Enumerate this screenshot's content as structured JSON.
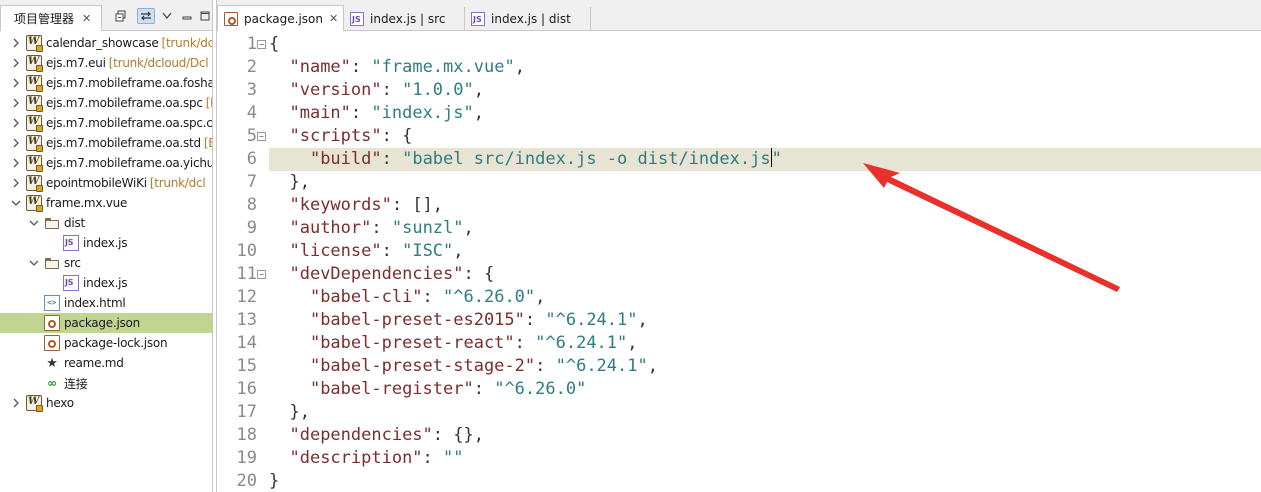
{
  "left_panel": {
    "tab_title": "项目管理器",
    "tree": [
      {
        "label": "calendar_showcase",
        "decor": "[trunk/dcloud/Dc",
        "icon": "project-icon",
        "level": 0,
        "expanded": false
      },
      {
        "label": "ejs.m7.eui",
        "decor": "[trunk/dcloud/Dcl",
        "icon": "project-icon",
        "level": 0,
        "expanded": false
      },
      {
        "label": "ejs.m7.mobileframe.oa.fosha",
        "decor": "",
        "icon": "project-icon",
        "level": 0,
        "expanded": false
      },
      {
        "label": "ejs.m7.mobileframe.oa.spc",
        "decor": "[l",
        "icon": "project-icon",
        "level": 0,
        "expanded": false
      },
      {
        "label": "ejs.m7.mobileframe.oa.spc.c",
        "decor": "",
        "icon": "project-icon",
        "level": 0,
        "expanded": false
      },
      {
        "label": "ejs.m7.mobileframe.oa.std",
        "decor": "[E",
        "icon": "project-icon",
        "level": 0,
        "expanded": false
      },
      {
        "label": "ejs.m7.mobileframe.oa.yichu",
        "decor": "",
        "icon": "project-icon",
        "level": 0,
        "expanded": false
      },
      {
        "label": "epointmobileWiKi",
        "decor": "[trunk/dcl",
        "icon": "project-icon",
        "level": 0,
        "expanded": false
      },
      {
        "label": "frame.mx.vue",
        "decor": "",
        "icon": "project-icon",
        "level": 0,
        "expanded": true
      },
      {
        "label": "dist",
        "decor": "",
        "icon": "folder-icon",
        "level": 1,
        "expanded": true
      },
      {
        "label": "index.js",
        "decor": "",
        "icon": "js-file-icon",
        "level": 2
      },
      {
        "label": "src",
        "decor": "",
        "icon": "folder-icon",
        "level": 1,
        "expanded": true
      },
      {
        "label": "index.js",
        "decor": "",
        "icon": "js-file-icon",
        "level": 2
      },
      {
        "label": "index.html",
        "decor": "",
        "icon": "html-file-icon",
        "level": 1
      },
      {
        "label": "package.json",
        "decor": "",
        "icon": "json-file-icon",
        "level": 1,
        "selected": true
      },
      {
        "label": "package-lock.json",
        "decor": "",
        "icon": "json-file-icon",
        "level": 1
      },
      {
        "label": "reame.md",
        "decor": "",
        "icon": "star-icon",
        "level": 1
      },
      {
        "label": "连接",
        "decor": "",
        "icon": "link-icon",
        "level": 1
      },
      {
        "label": "hexo",
        "decor": "",
        "icon": "project-icon",
        "level": 0,
        "expanded": false
      }
    ]
  },
  "editor": {
    "tabs": [
      {
        "label": "package.json",
        "icon": "json-file-icon",
        "active": true
      },
      {
        "label": "index.js | src",
        "icon": "js-file-icon",
        "active": false
      },
      {
        "label": "index.js | dist",
        "icon": "js-file-icon",
        "active": false
      }
    ],
    "lines": [
      {
        "n": "1",
        "fold": true,
        "tokens": [
          [
            "p",
            "{"
          ]
        ]
      },
      {
        "n": "2",
        "tokens": [
          [
            "p",
            "  "
          ],
          [
            "k",
            "\"name\""
          ],
          [
            "p",
            ": "
          ],
          [
            "s",
            "\"frame.mx.vue\""
          ],
          [
            "p",
            ","
          ]
        ]
      },
      {
        "n": "3",
        "tokens": [
          [
            "p",
            "  "
          ],
          [
            "k",
            "\"version\""
          ],
          [
            "p",
            ": "
          ],
          [
            "s",
            "\"1.0.0\""
          ],
          [
            "p",
            ","
          ]
        ]
      },
      {
        "n": "4",
        "tokens": [
          [
            "p",
            "  "
          ],
          [
            "k",
            "\"main\""
          ],
          [
            "p",
            ": "
          ],
          [
            "s",
            "\"index.js\""
          ],
          [
            "p",
            ","
          ]
        ]
      },
      {
        "n": "5",
        "fold": true,
        "tokens": [
          [
            "p",
            "  "
          ],
          [
            "k",
            "\"scripts\""
          ],
          [
            "p",
            ": {"
          ]
        ]
      },
      {
        "n": "6",
        "current": true,
        "tokens": [
          [
            "p",
            "    "
          ],
          [
            "k",
            "\"build\""
          ],
          [
            "p",
            ": "
          ],
          [
            "s",
            "\"babel src/index.js -o dist/index.js\""
          ]
        ]
      },
      {
        "n": "7",
        "tokens": [
          [
            "p",
            "  },"
          ]
        ]
      },
      {
        "n": "8",
        "tokens": [
          [
            "p",
            "  "
          ],
          [
            "k",
            "\"keywords\""
          ],
          [
            "p",
            ": [],"
          ]
        ]
      },
      {
        "n": "9",
        "tokens": [
          [
            "p",
            "  "
          ],
          [
            "k",
            "\"author\""
          ],
          [
            "p",
            ": "
          ],
          [
            "s",
            "\"sunzl\""
          ],
          [
            "p",
            ","
          ]
        ]
      },
      {
        "n": "10",
        "tokens": [
          [
            "p",
            "  "
          ],
          [
            "k",
            "\"license\""
          ],
          [
            "p",
            ": "
          ],
          [
            "s",
            "\"ISC\""
          ],
          [
            "p",
            ","
          ]
        ]
      },
      {
        "n": "11",
        "fold": true,
        "tokens": [
          [
            "p",
            "  "
          ],
          [
            "k",
            "\"devDependencies\""
          ],
          [
            "p",
            ": {"
          ]
        ]
      },
      {
        "n": "12",
        "tokens": [
          [
            "p",
            "    "
          ],
          [
            "k",
            "\"babel-cli\""
          ],
          [
            "p",
            ": "
          ],
          [
            "s",
            "\"^6.26.0\""
          ],
          [
            "p",
            ","
          ]
        ]
      },
      {
        "n": "13",
        "tokens": [
          [
            "p",
            "    "
          ],
          [
            "k",
            "\"babel-preset-es2015\""
          ],
          [
            "p",
            ": "
          ],
          [
            "s",
            "\"^6.24.1\""
          ],
          [
            "p",
            ","
          ]
        ]
      },
      {
        "n": "14",
        "tokens": [
          [
            "p",
            "    "
          ],
          [
            "k",
            "\"babel-preset-react\""
          ],
          [
            "p",
            ": "
          ],
          [
            "s",
            "\"^6.24.1\""
          ],
          [
            "p",
            ","
          ]
        ]
      },
      {
        "n": "15",
        "tokens": [
          [
            "p",
            "    "
          ],
          [
            "k",
            "\"babel-preset-stage-2\""
          ],
          [
            "p",
            ": "
          ],
          [
            "s",
            "\"^6.24.1\""
          ],
          [
            "p",
            ","
          ]
        ]
      },
      {
        "n": "16",
        "tokens": [
          [
            "p",
            "    "
          ],
          [
            "k",
            "\"babel-register\""
          ],
          [
            "p",
            ": "
          ],
          [
            "s",
            "\"^6.26.0\""
          ]
        ]
      },
      {
        "n": "17",
        "tokens": [
          [
            "p",
            "  },"
          ]
        ]
      },
      {
        "n": "18",
        "tokens": [
          [
            "p",
            "  "
          ],
          [
            "k",
            "\"dependencies\""
          ],
          [
            "p",
            ": {},"
          ]
        ]
      },
      {
        "n": "19",
        "tokens": [
          [
            "p",
            "  "
          ],
          [
            "k",
            "\"description\""
          ],
          [
            "p",
            ": "
          ],
          [
            "s",
            "\"\""
          ]
        ]
      },
      {
        "n": "20",
        "tokens": [
          [
            "p",
            "}"
          ]
        ]
      }
    ]
  },
  "colors": {
    "selection": "#c2d590",
    "current_line": "#e8e4d4",
    "key": "#7a2e2e",
    "string": "#2f7d84",
    "arrow": "#e8312a"
  }
}
